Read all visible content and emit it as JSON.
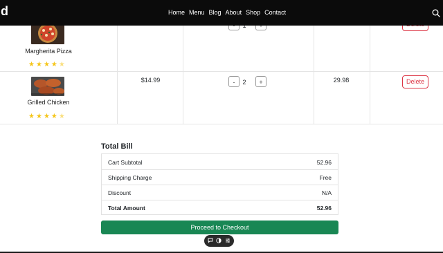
{
  "navbar": {
    "brand": "d",
    "links": [
      "Home",
      "Menu",
      "Blog",
      "About",
      "Shop",
      "Contact"
    ],
    "search_icon": "search-icon"
  },
  "cart": {
    "rows": [
      {
        "name": "Margherita Pizza",
        "rating": 4.5,
        "price": "",
        "quantity": "1",
        "total": "",
        "delete_label": "Delete",
        "image_icon": "pizza-image"
      },
      {
        "name": "Grilled Chicken",
        "rating": 4.5,
        "price": "$14.99",
        "quantity": "2",
        "total": "29.98",
        "delete_label": "Delete",
        "image_icon": "grilled-chicken-image"
      }
    ],
    "minus_label": "-",
    "plus_label": "+"
  },
  "bill": {
    "title": "Total Bill",
    "rows": [
      {
        "label": "Cart Subtotal",
        "value": "52.96"
      },
      {
        "label": "Shipping Charge",
        "value": "Free"
      },
      {
        "label": "Discount",
        "value": "N/A"
      },
      {
        "label": "Total Amount",
        "value": "52.96"
      }
    ],
    "checkout_label": "Proceed to Checkout"
  },
  "floating_toolbar": {
    "icons": [
      "comment-icon",
      "eye-icon",
      "sliders-icon"
    ]
  },
  "colors": {
    "navbar_bg": "#0b0b0b",
    "star": "#f5c518",
    "delete": "#dc3545",
    "checkout": "#198754"
  }
}
